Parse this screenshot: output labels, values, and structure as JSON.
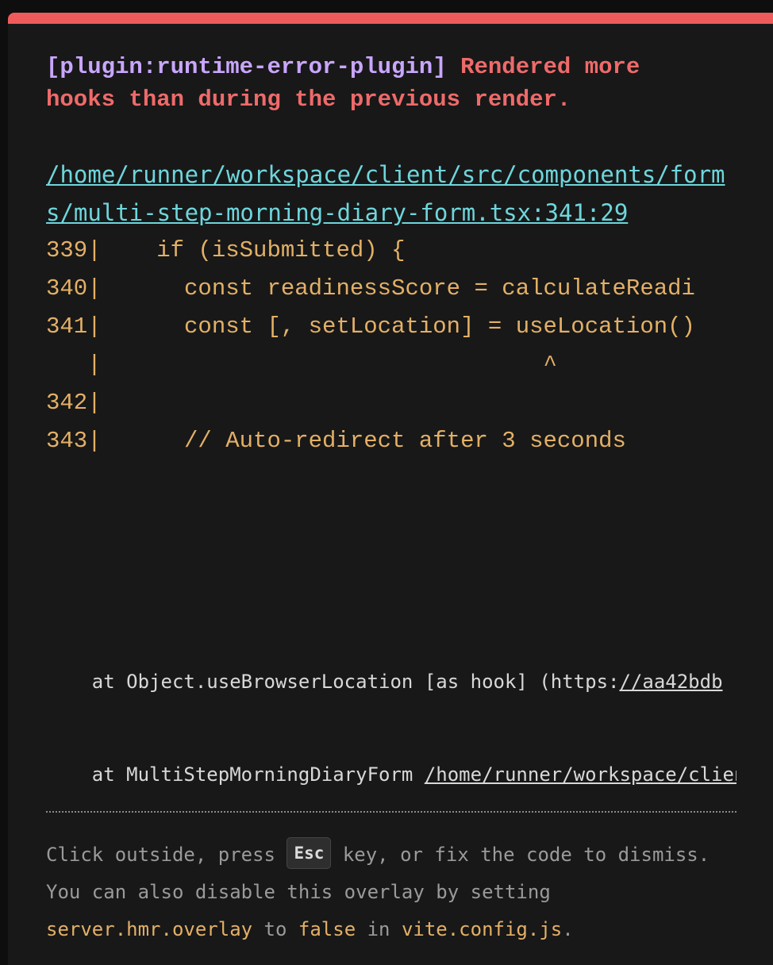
{
  "error": {
    "plugin": "[plugin:runtime-error-plugin]",
    "message": "Rendered more hooks than during the previous render."
  },
  "file": {
    "path": "/home/runner/workspace/client/src/components/forms/multi-step-morning-diary-form.tsx:341:29"
  },
  "code_frame": [
    "339|    if (isSubmitted) {",
    "340|      const readinessScore = calculateReadi",
    "341|      const [, setLocation] = useLocation()",
    "   |                                ^",
    "342|",
    "343|      // Auto-redirect after 3 seconds"
  ],
  "stack": [
    {
      "prefix": "    at Object.useBrowserLocation [as hook] (https:",
      "link": "//aa42bdb"
    },
    {
      "prefix": "    at MultiStepMorningDiaryForm ",
      "link": "/home/runner/workspace/client"
    }
  ],
  "tip": {
    "line1_before": "Click outside, press ",
    "key": "Esc",
    "line1_after": " key, or fix the code to dismiss.",
    "line2": "You can also disable this overlay by setting",
    "line3_code1": "server.hmr.overlay",
    "line3_mid1": " to ",
    "line3_code2": "false",
    "line3_mid2": " in ",
    "line3_code3": "vite.config.js",
    "line3_end": "."
  },
  "colors": {
    "accent_bar": "#ef5b5b",
    "plugin_text": "#c9a6ff",
    "message_text": "#ef6a6a",
    "file_link": "#6ed6dc",
    "code": "#e3b066"
  }
}
